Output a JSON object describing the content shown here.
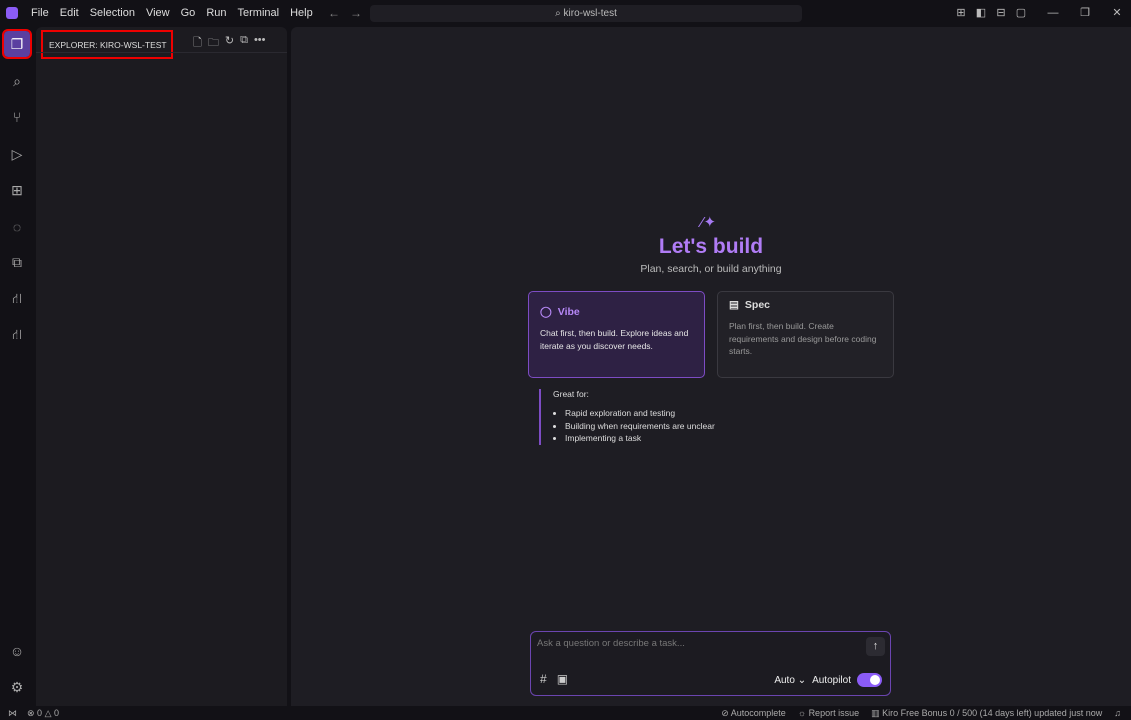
{
  "menu": [
    "File",
    "Edit",
    "Selection",
    "View",
    "Go",
    "Run",
    "Terminal",
    "Help"
  ],
  "search": {
    "label": "kiro-wsl-test",
    "icon": "search-icon"
  },
  "explorer": {
    "title": "EXPLORER: KIRO-WSL-TEST"
  },
  "welcome": {
    "title": "Let's build",
    "subtitle": "Plan, search, or build anything",
    "vibe": {
      "title": "Vibe",
      "desc": "Chat first, then build. Explore ideas and iterate as you discover needs."
    },
    "spec": {
      "title": "Spec",
      "desc": "Plan first, then build. Create requirements and design before coding starts."
    },
    "great_for": {
      "label": "Great for:",
      "items": [
        "Rapid exploration and testing",
        "Building when requirements are unclear",
        "Implementing a task"
      ]
    }
  },
  "chat": {
    "placeholder": "Ask a question or describe a task...",
    "model": "Auto",
    "autopilot": "Autopilot",
    "autopilot_on": true
  },
  "status": {
    "errors": "0",
    "warnings": "0",
    "autocomplete": "Autocomplete",
    "report": "Report issue",
    "bonus": "Kiro Free Bonus 0 / 500 (14 days left) updated just now"
  },
  "colors": {
    "accent": "#8b5cf6",
    "title": "#b07cf5"
  }
}
